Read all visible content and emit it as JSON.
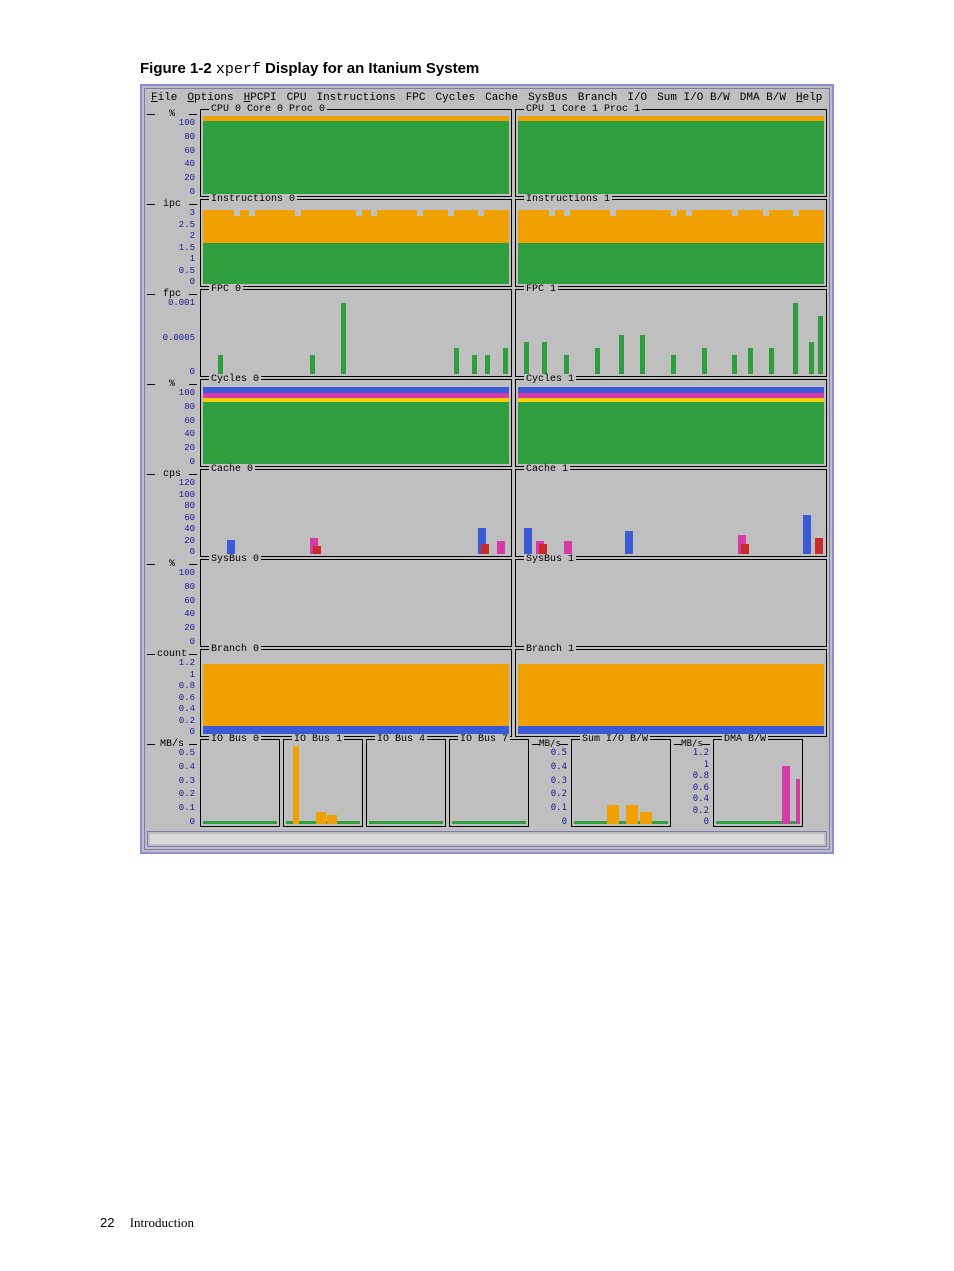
{
  "figure": {
    "number": "Figure  1-2",
    "code": "xperf",
    "rest": "Display for an Itanium System"
  },
  "menus": [
    "File",
    "Options",
    "HPCPI",
    "CPU",
    "Instructions",
    "FPC",
    "Cycles",
    "Cache",
    "SysBus",
    "Branch",
    "I/O",
    "Sum I/O B/W",
    "DMA B/W",
    "Help"
  ],
  "menu_underline": {
    "File": "F",
    "Options": "O",
    "HPCPI": "H",
    "Help": "H"
  },
  "rows": [
    {
      "axis_title": "%",
      "ticks": [
        "100",
        "80",
        "60",
        "40",
        "20",
        "0"
      ],
      "panels": [
        {
          "label": "CPU 0 Core 0 Proc 0"
        },
        {
          "label": "CPU 1 Core 1 Proc 1"
        }
      ],
      "kind": "cpu"
    },
    {
      "axis_title": "ipc",
      "ticks": [
        "3",
        "2.5",
        "2",
        "1.5",
        "1",
        "0.5",
        "0"
      ],
      "panels": [
        {
          "label": "Instructions 0"
        },
        {
          "label": "Instructions 1"
        }
      ],
      "kind": "instr"
    },
    {
      "axis_title": "fpc",
      "ticks": [
        "0.001",
        "",
        "0.0005",
        "",
        "0"
      ],
      "panels": [
        {
          "label": "FPC 0"
        },
        {
          "label": "FPC 1"
        }
      ],
      "kind": "fpc"
    },
    {
      "axis_title": "%",
      "ticks": [
        "100",
        "80",
        "60",
        "40",
        "20",
        "0"
      ],
      "panels": [
        {
          "label": "Cycles 0"
        },
        {
          "label": "Cycles 1"
        }
      ],
      "kind": "cyc"
    },
    {
      "axis_title": "cps",
      "ticks": [
        "120",
        "100",
        "80",
        "60",
        "40",
        "20",
        "0"
      ],
      "panels": [
        {
          "label": "Cache 0"
        },
        {
          "label": "Cache 1"
        }
      ],
      "kind": "cache"
    },
    {
      "axis_title": "%",
      "ticks": [
        "100",
        "80",
        "60",
        "40",
        "20",
        "0"
      ],
      "panels": [
        {
          "label": "SysBus 0"
        },
        {
          "label": "SysBus 1"
        }
      ],
      "kind": "sysbus"
    },
    {
      "axis_title": "count",
      "ticks": [
        "1.2",
        "1",
        "0.8",
        "0.6",
        "0.4",
        "0.2",
        "0"
      ],
      "panels": [
        {
          "label": "Branch 0"
        },
        {
          "label": "Branch 1"
        }
      ],
      "kind": "branch"
    }
  ],
  "io_row": {
    "left_axis": {
      "title": "MB/s",
      "ticks": [
        "0.5",
        "0.4",
        "0.3",
        "0.2",
        "0.1",
        "0"
      ]
    },
    "left_panels": [
      {
        "label": "IO Bus 0"
      },
      {
        "label": "IO Bus 1"
      },
      {
        "label": "IO Bus 4"
      },
      {
        "label": "IO Bus 7"
      }
    ],
    "mid_axis": {
      "title": "MB/s",
      "ticks": [
        "0.5",
        "0.4",
        "0.3",
        "0.2",
        "0.1",
        "0"
      ]
    },
    "mid_panel": {
      "label": "Sum I/O B/W"
    },
    "right_axis": {
      "title": "MB/s",
      "ticks": [
        "1.2",
        "1",
        "0.8",
        "0.6",
        "0.4",
        "0.2",
        "0"
      ]
    },
    "right_panel": {
      "label": "DMA B/W"
    }
  },
  "chart_data": {
    "type": "area",
    "note": "Values estimated from pixel positions against axis gridlines; time axis is implicit (unlabeled).",
    "charts": {
      "cpu": {
        "ylim": [
          0,
          100
        ],
        "unit": "%",
        "series_per_panel": [
          {
            "panel": "CPU 0 Core 0 Proc 0",
            "baseline": 95,
            "description": "near-constant ~95% with minor orange user band at top"
          },
          {
            "panel": "CPU 1 Core 1 Proc 1",
            "baseline": 95,
            "description": "near-constant ~95%"
          }
        ]
      },
      "instructions": {
        "ylim": [
          0,
          3
        ],
        "unit": "ipc",
        "series_per_panel": [
          {
            "panel": "Instructions 0",
            "green_level": 1.5,
            "orange_top": 2.8,
            "notch_positions_pct": [
              10,
              30,
              55,
              70,
              90
            ]
          },
          {
            "panel": "Instructions 1",
            "green_level": 1.5,
            "orange_top": 2.8,
            "notch_positions_pct": [
              5,
              25,
              45,
              75,
              95
            ]
          }
        ]
      },
      "fpc": {
        "ylim": [
          0,
          0.0012
        ],
        "unit": "fpc",
        "series_per_panel": [
          {
            "panel": "FPC 0",
            "spikes": [
              {
                "x_pct": 5,
                "h": 0.0003
              },
              {
                "x_pct": 35,
                "h": 0.0003
              },
              {
                "x_pct": 45,
                "h": 0.0011
              },
              {
                "x_pct": 82,
                "h": 0.0004
              },
              {
                "x_pct": 88,
                "h": 0.0003
              },
              {
                "x_pct": 92,
                "h": 0.0003
              },
              {
                "x_pct": 98,
                "h": 0.0004
              }
            ]
          },
          {
            "panel": "FPC 1",
            "spikes": [
              {
                "x_pct": 2,
                "h": 0.0005
              },
              {
                "x_pct": 8,
                "h": 0.0005
              },
              {
                "x_pct": 15,
                "h": 0.0003
              },
              {
                "x_pct": 25,
                "h": 0.0004
              },
              {
                "x_pct": 33,
                "h": 0.0006
              },
              {
                "x_pct": 40,
                "h": 0.0006
              },
              {
                "x_pct": 50,
                "h": 0.0003
              },
              {
                "x_pct": 60,
                "h": 0.0004
              },
              {
                "x_pct": 70,
                "h": 0.0003
              },
              {
                "x_pct": 75,
                "h": 0.0004
              },
              {
                "x_pct": 82,
                "h": 0.0004
              },
              {
                "x_pct": 90,
                "h": 0.0011
              },
              {
                "x_pct": 95,
                "h": 0.0005
              },
              {
                "x_pct": 98,
                "h": 0.0009
              }
            ]
          }
        ]
      },
      "cycles": {
        "ylim": [
          0,
          100
        ],
        "unit": "%",
        "series_per_panel": [
          {
            "panel": "Cycles 0",
            "green": 80,
            "yellow": 4,
            "magenta": 5,
            "blue": 6
          },
          {
            "panel": "Cycles 1",
            "green": 80,
            "yellow": 4,
            "magenta": 5,
            "blue": 6
          }
        ]
      },
      "cache": {
        "ylim": [
          0,
          120
        ],
        "unit": "cps",
        "series_per_panel": [
          {
            "panel": "Cache 0",
            "bars": [
              {
                "x_pct": 8,
                "h": 22,
                "c": "blue"
              },
              {
                "x_pct": 35,
                "h": 25,
                "c": "magenta"
              },
              {
                "x_pct": 36,
                "h": 12,
                "c": "red"
              },
              {
                "x_pct": 90,
                "h": 40,
                "c": "blue"
              },
              {
                "x_pct": 91,
                "h": 15,
                "c": "red"
              },
              {
                "x_pct": 96,
                "h": 20,
                "c": "magenta"
              }
            ]
          },
          {
            "panel": "Cache 1",
            "bars": [
              {
                "x_pct": 2,
                "h": 40,
                "c": "blue"
              },
              {
                "x_pct": 6,
                "h": 20,
                "c": "magenta"
              },
              {
                "x_pct": 7,
                "h": 15,
                "c": "red"
              },
              {
                "x_pct": 15,
                "h": 20,
                "c": "magenta"
              },
              {
                "x_pct": 35,
                "h": 35,
                "c": "blue"
              },
              {
                "x_pct": 72,
                "h": 30,
                "c": "magenta"
              },
              {
                "x_pct": 73,
                "h": 15,
                "c": "red"
              },
              {
                "x_pct": 93,
                "h": 60,
                "c": "blue"
              },
              {
                "x_pct": 97,
                "h": 25,
                "c": "red"
              }
            ]
          }
        ]
      },
      "sysbus": {
        "ylim": [
          0,
          100
        ],
        "unit": "%",
        "series_per_panel": [
          {
            "panel": "SysBus 0",
            "baseline": 0
          },
          {
            "panel": "SysBus 1",
            "baseline": 0
          }
        ]
      },
      "branch": {
        "ylim": [
          0,
          1.2
        ],
        "unit": "count",
        "series_per_panel": [
          {
            "panel": "Branch 0",
            "blue_bottom": 0.12,
            "orange_fill_to": 1.05
          },
          {
            "panel": "Branch 1",
            "blue_bottom": 0.12,
            "orange_fill_to": 1.05
          }
        ]
      },
      "io": {
        "unit": "MB/s",
        "panels": [
          {
            "label": "IO Bus 0",
            "ylim": [
              0,
              0.5
            ],
            "baseline": 0.02,
            "description": "flat near zero"
          },
          {
            "label": "IO Bus 1",
            "ylim": [
              0,
              0.5
            ],
            "baseline": 0.05,
            "spike": {
              "x_pct": 10,
              "h": 0.5
            },
            "bumps": [
              {
                "x_pct": 40,
                "h": 0.08
              },
              {
                "x_pct": 55,
                "h": 0.06
              }
            ]
          },
          {
            "label": "IO Bus 4",
            "ylim": [
              0,
              0.5
            ],
            "baseline": 0.01
          },
          {
            "label": "IO Bus 7",
            "ylim": [
              0,
              0.5
            ],
            "baseline": 0.01
          },
          {
            "label": "Sum I/O B/W",
            "ylim": [
              0,
              0.5
            ],
            "baseline": 0.06,
            "bumps": [
              {
                "x_pct": 35,
                "h": 0.12
              },
              {
                "x_pct": 55,
                "h": 0.12
              },
              {
                "x_pct": 70,
                "h": 0.08
              }
            ]
          },
          {
            "label": "DMA B/W",
            "ylim": [
              0,
              1.2
            ],
            "baseline": 0.05,
            "bars": [
              {
                "x_pct": 78,
                "h": 0.9,
                "c": "magenta"
              },
              {
                "x_pct": 95,
                "h": 0.7,
                "c": "magenta"
              }
            ]
          }
        ]
      }
    }
  },
  "footer": {
    "page": "22",
    "section": "Introduction"
  }
}
